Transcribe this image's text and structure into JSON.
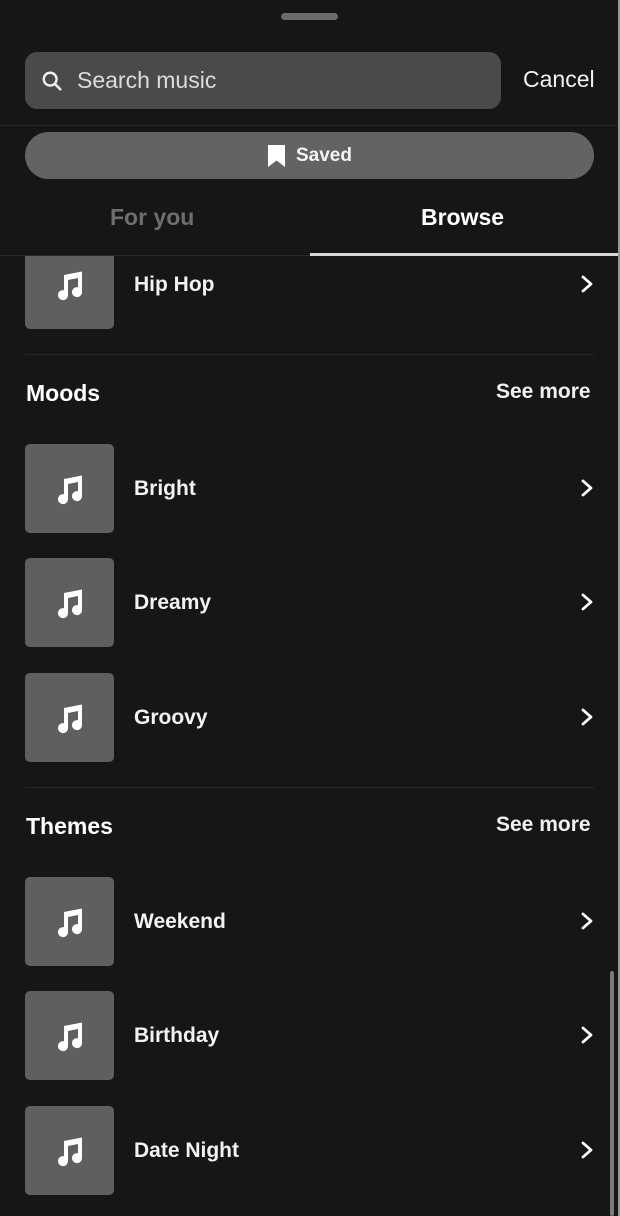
{
  "search": {
    "placeholder": "Search music",
    "value": "",
    "icon": "search-icon",
    "cancel_label": "Cancel"
  },
  "saved_button": {
    "label": "Saved",
    "icon": "bookmark-icon"
  },
  "tabs": [
    {
      "label": "For you",
      "active": false
    },
    {
      "label": "Browse",
      "active": true
    }
  ],
  "genres": {
    "items": [
      {
        "label": "Hip Hop",
        "icon": "music-note-icon"
      }
    ]
  },
  "moods": {
    "title": "Moods",
    "see_more_label": "See more",
    "items": [
      {
        "label": "Bright",
        "icon": "music-note-icon"
      },
      {
        "label": "Dreamy",
        "icon": "music-note-icon"
      },
      {
        "label": "Groovy",
        "icon": "music-note-icon"
      }
    ]
  },
  "themes": {
    "title": "Themes",
    "see_more_label": "See more",
    "items": [
      {
        "label": "Weekend",
        "icon": "music-note-icon"
      },
      {
        "label": "Birthday",
        "icon": "music-note-icon"
      },
      {
        "label": "Date Night",
        "icon": "music-note-icon"
      }
    ]
  },
  "colors": {
    "background": "#151616",
    "search_bg": "#4a4a4a",
    "saved_bg": "#636363",
    "thumb_bg": "#5f5f5f",
    "inactive_tab": "#6e6e6e",
    "text": "#ffffff"
  }
}
